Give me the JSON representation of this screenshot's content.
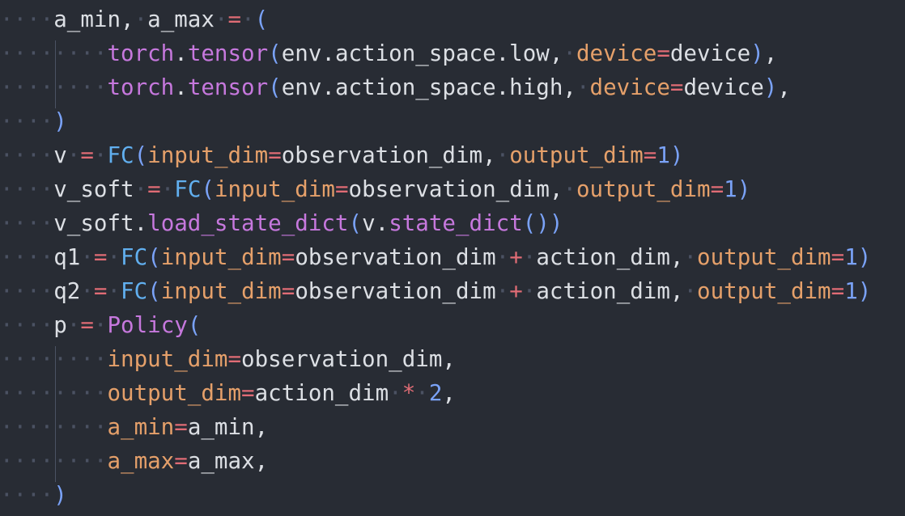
{
  "code": {
    "lines": [
      [
        [
          "ws",
          "····"
        ],
        [
          "var",
          "a_min,"
        ],
        [
          "ws",
          "·"
        ],
        [
          "var",
          "a_max"
        ],
        [
          "ws",
          "·"
        ],
        [
          "op",
          "="
        ],
        [
          "ws",
          "·"
        ],
        [
          "paren",
          "("
        ]
      ],
      [
        [
          "ws",
          "········"
        ],
        [
          "mod",
          "torch"
        ],
        [
          "dot",
          "."
        ],
        [
          "func",
          "tensor"
        ],
        [
          "paren",
          "("
        ],
        [
          "var",
          "env.action_space.low,"
        ],
        [
          "ws",
          "·"
        ],
        [
          "kw",
          "device"
        ],
        [
          "op",
          "="
        ],
        [
          "var",
          "device"
        ],
        [
          "paren",
          ")"
        ],
        [
          "var",
          ","
        ]
      ],
      [
        [
          "ws",
          "········"
        ],
        [
          "mod",
          "torch"
        ],
        [
          "dot",
          "."
        ],
        [
          "func",
          "tensor"
        ],
        [
          "paren",
          "("
        ],
        [
          "var",
          "env.action_space.high,"
        ],
        [
          "ws",
          "·"
        ],
        [
          "kw",
          "device"
        ],
        [
          "op",
          "="
        ],
        [
          "var",
          "device"
        ],
        [
          "paren",
          ")"
        ],
        [
          "var",
          ","
        ]
      ],
      [
        [
          "ws",
          "····"
        ],
        [
          "paren",
          ")"
        ]
      ],
      [
        [
          "ws",
          "····"
        ],
        [
          "var",
          "v"
        ],
        [
          "ws",
          "·"
        ],
        [
          "op",
          "="
        ],
        [
          "ws",
          "·"
        ],
        [
          "cls",
          "FC"
        ],
        [
          "paren",
          "("
        ],
        [
          "kw",
          "input_dim"
        ],
        [
          "op",
          "="
        ],
        [
          "var",
          "observation_dim,"
        ],
        [
          "ws",
          "·"
        ],
        [
          "kw",
          "output_dim"
        ],
        [
          "op",
          "="
        ],
        [
          "num",
          "1"
        ],
        [
          "paren",
          ")"
        ]
      ],
      [
        [
          "ws",
          "····"
        ],
        [
          "var",
          "v_soft"
        ],
        [
          "ws",
          "·"
        ],
        [
          "op",
          "="
        ],
        [
          "ws",
          "·"
        ],
        [
          "cls",
          "FC"
        ],
        [
          "paren",
          "("
        ],
        [
          "kw",
          "input_dim"
        ],
        [
          "op",
          "="
        ],
        [
          "var",
          "observation_dim,"
        ],
        [
          "ws",
          "·"
        ],
        [
          "kw",
          "output_dim"
        ],
        [
          "op",
          "="
        ],
        [
          "num",
          "1"
        ],
        [
          "paren",
          ")"
        ]
      ],
      [
        [
          "ws",
          "····"
        ],
        [
          "var",
          "v_soft"
        ],
        [
          "dot",
          "."
        ],
        [
          "func",
          "load_state_dict"
        ],
        [
          "paren",
          "("
        ],
        [
          "var",
          "v"
        ],
        [
          "dot",
          "."
        ],
        [
          "func",
          "state_dict"
        ],
        [
          "paren",
          "())"
        ]
      ],
      [
        [
          "ws",
          "····"
        ],
        [
          "var",
          "q1"
        ],
        [
          "ws",
          "·"
        ],
        [
          "op",
          "="
        ],
        [
          "ws",
          "·"
        ],
        [
          "cls",
          "FC"
        ],
        [
          "paren",
          "("
        ],
        [
          "kw",
          "input_dim"
        ],
        [
          "op",
          "="
        ],
        [
          "var",
          "observation_dim"
        ],
        [
          "ws",
          "·"
        ],
        [
          "op",
          "+"
        ],
        [
          "ws",
          "·"
        ],
        [
          "var",
          "action_dim,"
        ],
        [
          "ws",
          "·"
        ],
        [
          "kw",
          "output_dim"
        ],
        [
          "op",
          "="
        ],
        [
          "num",
          "1"
        ],
        [
          "paren",
          ")"
        ]
      ],
      [
        [
          "ws",
          "····"
        ],
        [
          "var",
          "q2"
        ],
        [
          "ws",
          "·"
        ],
        [
          "op",
          "="
        ],
        [
          "ws",
          "·"
        ],
        [
          "cls",
          "FC"
        ],
        [
          "paren",
          "("
        ],
        [
          "kw",
          "input_dim"
        ],
        [
          "op",
          "="
        ],
        [
          "var",
          "observation_dim"
        ],
        [
          "ws",
          "·"
        ],
        [
          "op",
          "+"
        ],
        [
          "ws",
          "·"
        ],
        [
          "var",
          "action_dim,"
        ],
        [
          "ws",
          "·"
        ],
        [
          "kw",
          "output_dim"
        ],
        [
          "op",
          "="
        ],
        [
          "num",
          "1"
        ],
        [
          "paren",
          ")"
        ]
      ],
      [
        [
          "ws",
          "····"
        ],
        [
          "var",
          "p"
        ],
        [
          "ws",
          "·"
        ],
        [
          "op",
          "="
        ],
        [
          "ws",
          "·"
        ],
        [
          "func",
          "Policy"
        ],
        [
          "paren",
          "("
        ]
      ],
      [
        [
          "ws",
          "········"
        ],
        [
          "kw",
          "input_dim"
        ],
        [
          "op",
          "="
        ],
        [
          "var",
          "observation_dim,"
        ]
      ],
      [
        [
          "ws",
          "········"
        ],
        [
          "kw",
          "output_dim"
        ],
        [
          "op",
          "="
        ],
        [
          "var",
          "action_dim"
        ],
        [
          "ws",
          "·"
        ],
        [
          "op",
          "*"
        ],
        [
          "ws",
          "·"
        ],
        [
          "num",
          "2"
        ],
        [
          "var",
          ","
        ]
      ],
      [
        [
          "ws",
          "········"
        ],
        [
          "kw",
          "a_min"
        ],
        [
          "op",
          "="
        ],
        [
          "var",
          "a_min,"
        ]
      ],
      [
        [
          "ws",
          "········"
        ],
        [
          "kw",
          "a_max"
        ],
        [
          "op",
          "="
        ],
        [
          "var",
          "a_max,"
        ]
      ],
      [
        [
          "ws",
          "····"
        ],
        [
          "paren",
          ")"
        ]
      ]
    ]
  }
}
